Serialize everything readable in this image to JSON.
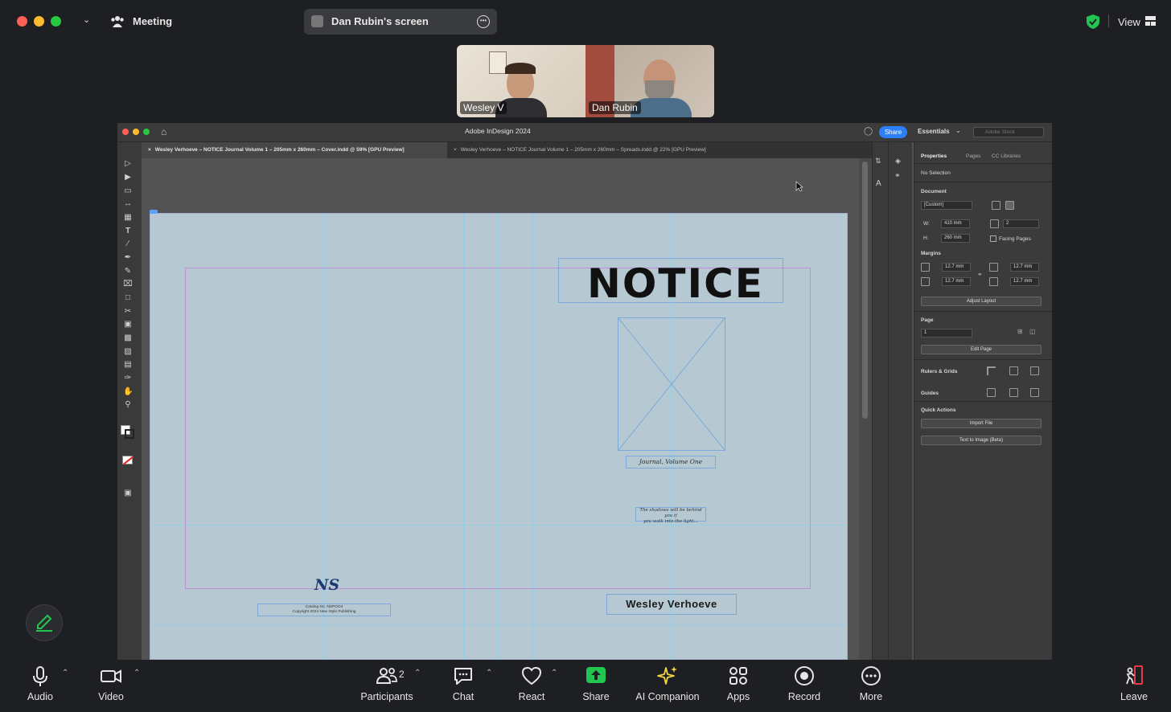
{
  "zoom": {
    "meeting_label": "Meeting",
    "screen_share_label": "Dan Rubin's screen",
    "view_label": "View",
    "participants": [
      {
        "name": "Wesley V"
      },
      {
        "name": "Dan Rubin"
      }
    ],
    "participants_count": "2",
    "toolbar": {
      "audio": "Audio",
      "video": "Video",
      "participants": "Participants",
      "chat": "Chat",
      "react": "React",
      "share": "Share",
      "ai_companion": "AI Companion",
      "apps": "Apps",
      "record": "Record",
      "more": "More",
      "leave": "Leave"
    },
    "colors": {
      "share_green": "#23c552",
      "ai_yellow": "#f5d547",
      "leave_red": "#e8394a"
    }
  },
  "indesign": {
    "app_title": "Adobe InDesign 2024",
    "share_label": "Share",
    "workspace_label": "Essentials",
    "search_placeholder": "Adobe Stock",
    "tabs": [
      "Wesley Verhoeve – NOTICE Journal Volume 1 – 205mm x 260mm – Cover.indd @ 59% [GPU Preview]",
      "Wesley Verhoeve – NOTICE Journal Volume 1 – 205mm x 260mm – Spreads.indd @ 22% [GPU Preview]"
    ],
    "document": {
      "title": "NOTICE",
      "subtitle": "Journal, Volume One",
      "quote_line1": "The shadows will be behind you if",
      "quote_line2": "you walk into the light...",
      "author": "Wesley Verhoeve",
      "logo_text": "NS",
      "catalog_line1": "Catalog No. NSPOO4",
      "catalog_line2": "Copyright 2024 New Style Publishing"
    },
    "panel": {
      "tab_properties": "Properties",
      "tab_pages": "Pages",
      "tab_cc": "CC Libraries",
      "selection": "No Selection",
      "document_heading": "Document",
      "preset": "[Custom]",
      "w_label": "W:",
      "w_value": "410 mm",
      "h_label": "H:",
      "h_value": "260 mm",
      "pages_value": "2",
      "facing_pages": "Facing Pages",
      "margins_heading": "Margins",
      "margin_top": "12.7 mm",
      "margin_bottom": "12.7 mm",
      "margin_left": "12.7 mm",
      "margin_right": "12.7 mm",
      "adjust_layout": "Adjust Layout",
      "page_heading": "Page",
      "page_value": "1",
      "edit_page": "Edit Page",
      "rulers_grids": "Rulers & Grids",
      "guides": "Guides",
      "quick_actions": "Quick Actions",
      "import_file": "Import File",
      "text_to_image": "Text to Image (Beta)"
    }
  }
}
